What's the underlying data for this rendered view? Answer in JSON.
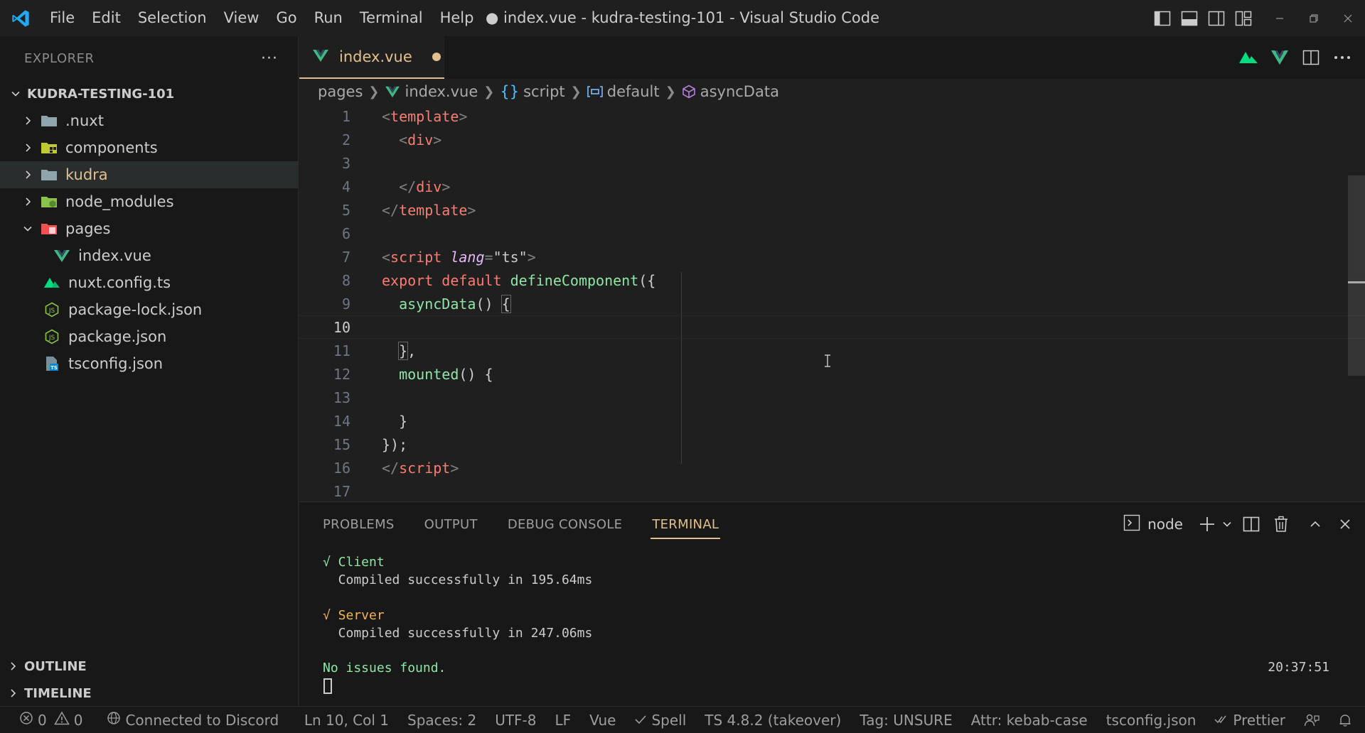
{
  "window": {
    "title": "● index.vue - kudra-testing-101 - Visual Studio Code",
    "menu": [
      "File",
      "Edit",
      "Selection",
      "View",
      "Go",
      "Run",
      "Terminal",
      "Help"
    ]
  },
  "explorer": {
    "header": "EXPLORER",
    "more": "···",
    "project": "KUDRA-TESTING-101",
    "items": [
      {
        "label": ".nuxt",
        "type": "folder",
        "indent": 0,
        "expanded": false,
        "icon": "folder-icon"
      },
      {
        "label": "components",
        "type": "folder",
        "indent": 0,
        "expanded": false,
        "icon": "folder-components-icon"
      },
      {
        "label": "kudra",
        "type": "folder",
        "indent": 0,
        "expanded": false,
        "icon": "folder-icon",
        "selected": true,
        "highlight": true
      },
      {
        "label": "node_modules",
        "type": "folder",
        "indent": 0,
        "expanded": false,
        "icon": "folder-node-icon"
      },
      {
        "label": "pages",
        "type": "folder",
        "indent": 0,
        "expanded": true,
        "icon": "folder-pages-icon"
      },
      {
        "label": "index.vue",
        "type": "file",
        "indent": 1,
        "icon": "vue-file-icon"
      },
      {
        "label": "nuxt.config.ts",
        "type": "file",
        "indent": 0,
        "icon": "nuxt-file-icon"
      },
      {
        "label": "package-lock.json",
        "type": "file",
        "indent": 0,
        "icon": "node-json-icon"
      },
      {
        "label": "package.json",
        "type": "file",
        "indent": 0,
        "icon": "node-json-icon"
      },
      {
        "label": "tsconfig.json",
        "type": "file",
        "indent": 0,
        "icon": "tsconfig-file-icon"
      }
    ],
    "outline": "OUTLINE",
    "timeline": "TIMELINE"
  },
  "editor": {
    "tab": {
      "label": "index.vue",
      "dirty": true
    },
    "breadcrumb": [
      "pages",
      "index.vue",
      "script",
      "default",
      "asyncData"
    ],
    "active_line": 10,
    "lines": [
      {
        "n": "1"
      },
      {
        "n": "2"
      },
      {
        "n": "3"
      },
      {
        "n": "4"
      },
      {
        "n": "5"
      },
      {
        "n": "6"
      },
      {
        "n": "7"
      },
      {
        "n": "8"
      },
      {
        "n": "9"
      },
      {
        "n": "10"
      },
      {
        "n": "11"
      },
      {
        "n": "12"
      },
      {
        "n": "13"
      },
      {
        "n": "14"
      },
      {
        "n": "15"
      },
      {
        "n": "16"
      },
      {
        "n": "17"
      }
    ]
  },
  "panel": {
    "tabs": [
      "PROBLEMS",
      "OUTPUT",
      "DEBUG CONSOLE",
      "TERMINAL"
    ],
    "active_tab": "TERMINAL",
    "terminal_name": "node",
    "terminal": {
      "client_title": "√ Client",
      "client_msg": "  Compiled successfully in 195.64ms",
      "server_title": "√ Server",
      "server_msg": "  Compiled successfully in 247.06ms",
      "issues": "No issues found.",
      "time": "20:37:51"
    }
  },
  "statusbar": {
    "errors": "0",
    "warnings": "0",
    "discord": "Connected to Discord",
    "position": "Ln 10, Col 1",
    "spaces": "Spaces: 2",
    "encoding": "UTF-8",
    "eol": "LF",
    "language": "Vue",
    "spell": "Spell",
    "ts": "TS 4.8.2 (takeover)",
    "tag": "Tag: UNSURE",
    "attr": "Attr: kebab-case",
    "tsconfig": "tsconfig.json",
    "prettier": "Prettier"
  },
  "colors": {
    "accent": "#e2c08d",
    "vue_green": "#41b883",
    "vscode_blue": "#23a9f2",
    "terminal_green": "#8ee6a5",
    "terminal_orange": "#f0b45a"
  }
}
